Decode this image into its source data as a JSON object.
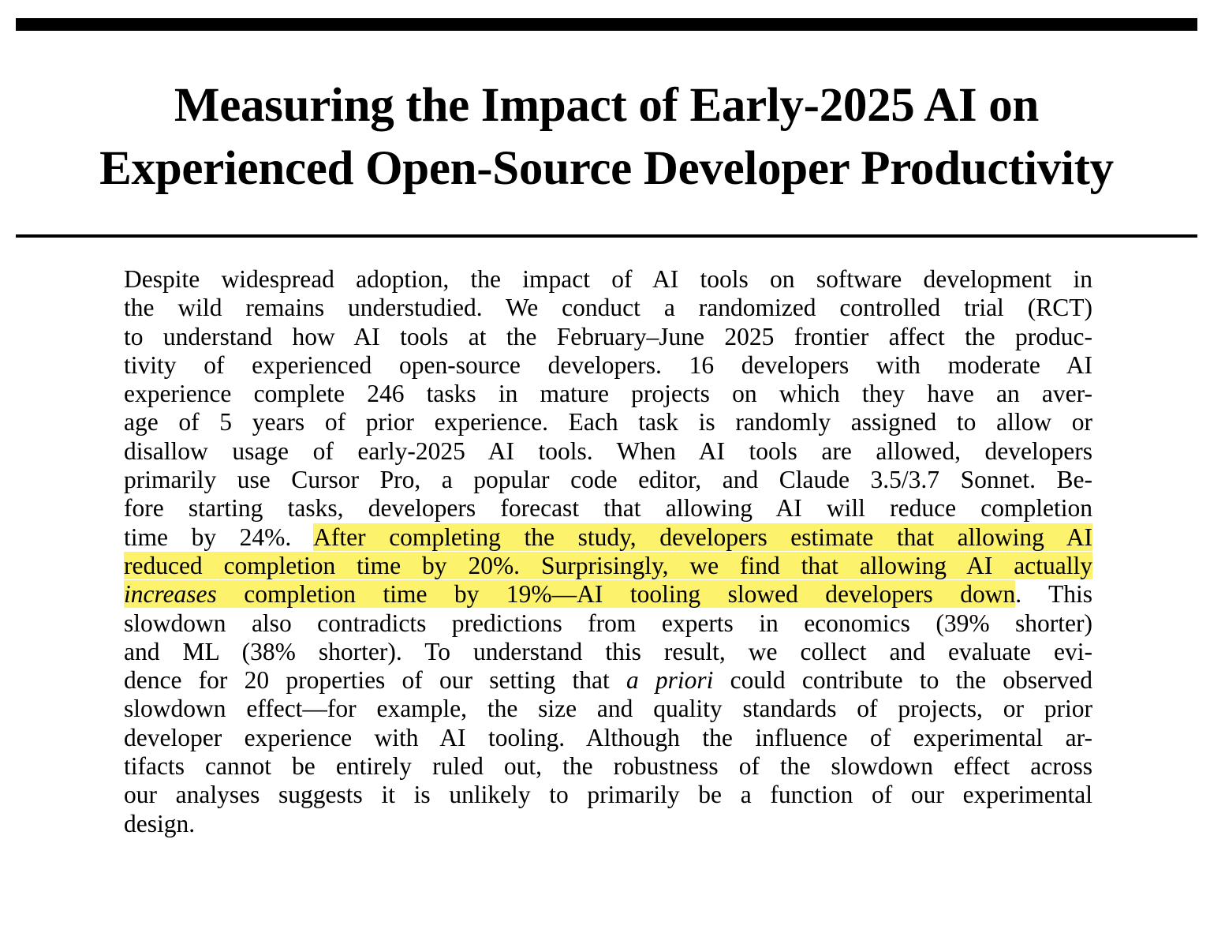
{
  "title": {
    "line1": "Measuring the Impact of Early-2025 AI on",
    "line2": "Experienced Open-Source Developer Productivity"
  },
  "abstract": {
    "l1": "Despite widespread adoption, the impact of AI tools on software development in",
    "l2": "the wild remains understudied.  We conduct a randomized controlled trial (RCT)",
    "l3": "to understand how AI tools at the February–June 2025 frontier affect the produc-",
    "l4": "tivity of experienced open-source developers.  16 developers with moderate AI",
    "l5": "experience complete 246 tasks in mature projects on which they have an aver-",
    "l6": "age of 5 years of prior experience.  Each task is randomly assigned to allow or",
    "l7": "disallow usage of early-2025 AI tools.  When AI tools are allowed, developers",
    "l8": "primarily use Cursor Pro, a popular code editor, and Claude 3.5/3.7 Sonnet.  Be-",
    "l9": "fore starting tasks, developers forecast that allowing AI will reduce completion",
    "l10a": "time by 24%. ",
    "l10b": "After completing the study, developers estimate that allowing AI",
    "l11": "reduced completion time by 20%. Surprisingly, we find that allowing AI actually",
    "l12a": "increases",
    "l12b": " completion time by 19%—AI tooling slowed developers down",
    "l12c": ".  This",
    "l13": "slowdown also contradicts predictions from experts in economics (39% shorter)",
    "l14": "and ML (38% shorter).  To understand this result, we collect and evaluate evi-",
    "l15a": "dence for 20 properties of our setting that ",
    "l15b": "a priori",
    "l15c": " could contribute to the observed",
    "l16": "slowdown effect—for example, the size and quality standards of projects, or prior",
    "l17": "developer experience with AI tooling. Although the influence of experimental ar-",
    "l18": "tifacts cannot be entirely ruled out, the robustness of the slowdown effect across",
    "l19": "our analyses suggests it is unlikely to primarily be a function of our experimental",
    "l20": "design."
  },
  "colors": {
    "highlight": "#fdf26b",
    "text": "#000000",
    "rule": "#000000"
  }
}
